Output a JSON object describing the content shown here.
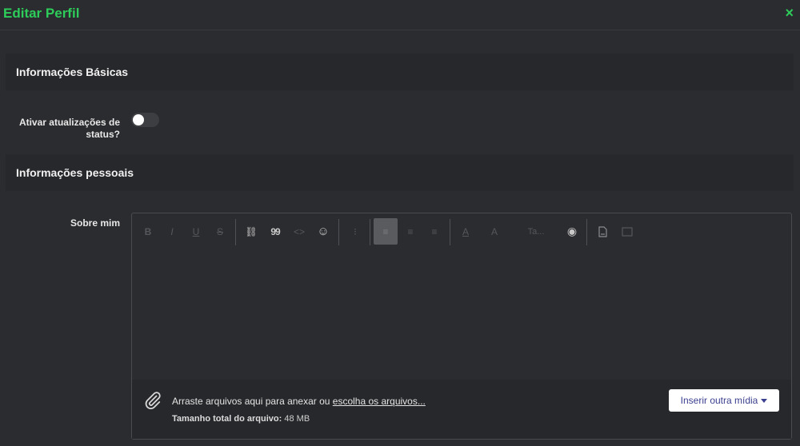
{
  "header": {
    "title": "Editar Perfil",
    "close_glyph": "×"
  },
  "sections": {
    "basic": "Informações Básicas",
    "personal": "Informações pessoais"
  },
  "status_toggle": {
    "label": "Ativar atualizações de status?",
    "enabled": false
  },
  "about": {
    "label": "Sobre mim"
  },
  "toolbar": {
    "bold": "B",
    "italic": "I",
    "underline": "U",
    "strike": "S",
    "link": "⛓",
    "quote": "99",
    "code": "<>",
    "emoji": "☺",
    "list": "⁝",
    "align_left": "≡",
    "align_center": "≡",
    "align_right": "≡",
    "text_color": "A",
    "bg_color": "A",
    "size": "Ta...",
    "preview": "◉"
  },
  "attachments": {
    "drag_text": "Arraste arquivos aqui para anexar ou",
    "choose_link": "escolha os arquivos...",
    "size_label": "Tamanho total do arquivo:",
    "size_value": "48 MB",
    "insert_media": "Inserir outra mídia"
  },
  "colors": {
    "accent": "#2ecc5a",
    "background": "#2b2c2f",
    "panel": "#27282b"
  }
}
